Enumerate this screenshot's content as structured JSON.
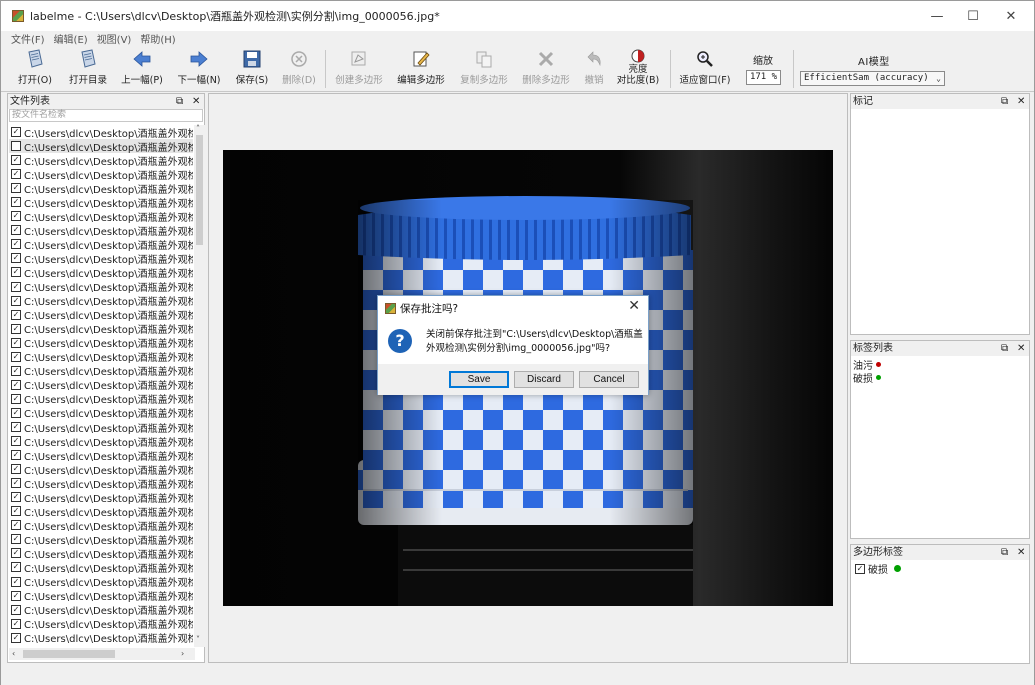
{
  "window": {
    "title": "labelme - C:\\Users\\dlcv\\Desktop\\酒瓶盖外观检测\\实例分割\\img_0000056.jpg*",
    "minimize": "—",
    "maximize": "☐",
    "close": "✕"
  },
  "menu": [
    "文件(F)",
    "编辑(E)",
    "视图(V)",
    "帮助(H)"
  ],
  "toolbar": {
    "open": "打开(O)",
    "open_dir": "打开目录",
    "prev": "上一幅(P)",
    "next": "下一幅(N)",
    "save": "保存(S)",
    "delete": "删除(D)",
    "create_polygon": "创建多边形",
    "edit_polygon": "编辑多边形",
    "copy_polygon": "复制多边形",
    "delete_polygon": "删除多边形",
    "undo": "撤销",
    "brightness_line1": "亮度",
    "brightness_line2": "对比度(B)",
    "fit_window": "适应窗口(F)",
    "zoom_label": "缩放",
    "zoom_value": "171 %",
    "ai_label": "AI模型",
    "ai_model": "EfficientSam (accuracy)"
  },
  "file_dock": {
    "title": "文件列表",
    "search_placeholder": "按文件名检索",
    "file_label": "C:\\Users\\dlcv\\Desktop\\酒瓶盖外观检",
    "files": [
      {
        "checked": true
      },
      {
        "checked": false,
        "selected": true
      },
      {
        "checked": true
      },
      {
        "checked": true
      },
      {
        "checked": true
      },
      {
        "checked": true
      },
      {
        "checked": true
      },
      {
        "checked": true
      },
      {
        "checked": true
      },
      {
        "checked": true
      },
      {
        "checked": true
      },
      {
        "checked": true
      },
      {
        "checked": true
      },
      {
        "checked": true
      },
      {
        "checked": true
      },
      {
        "checked": true
      },
      {
        "checked": true
      },
      {
        "checked": true
      },
      {
        "checked": true
      },
      {
        "checked": true
      },
      {
        "checked": true
      },
      {
        "checked": true
      },
      {
        "checked": true
      },
      {
        "checked": true
      },
      {
        "checked": true
      },
      {
        "checked": true
      },
      {
        "checked": true
      },
      {
        "checked": true
      },
      {
        "checked": true
      },
      {
        "checked": true
      },
      {
        "checked": true
      },
      {
        "checked": true
      },
      {
        "checked": true
      },
      {
        "checked": true
      },
      {
        "checked": true
      },
      {
        "checked": true
      },
      {
        "checked": true
      }
    ]
  },
  "label_dock": {
    "title": "标记"
  },
  "label_list_dock": {
    "title": "标签列表",
    "items": [
      {
        "name": "油污",
        "color": "#c00000"
      },
      {
        "name": "破损",
        "color": "#00a000"
      }
    ]
  },
  "poly_dock": {
    "title": "多边形标签",
    "items": [
      {
        "name": "破损",
        "color": "#00a000",
        "checked": true
      }
    ]
  },
  "dock_buttons": {
    "float": "⧉",
    "close": "✕"
  },
  "dialog": {
    "title": "保存批注吗?",
    "icon": "?",
    "message": "关闭前保存批注到\"C:\\Users\\dlcv\\Desktop\\酒瓶盖外观检测\\实例分割\\img_0000056.jpg\"吗?",
    "save": "Save",
    "discard": "Discard",
    "cancel": "Cancel",
    "close": "✕"
  },
  "colors": {
    "cap_blue": "#2f6fe0",
    "cap_white": "#e8eef8"
  }
}
